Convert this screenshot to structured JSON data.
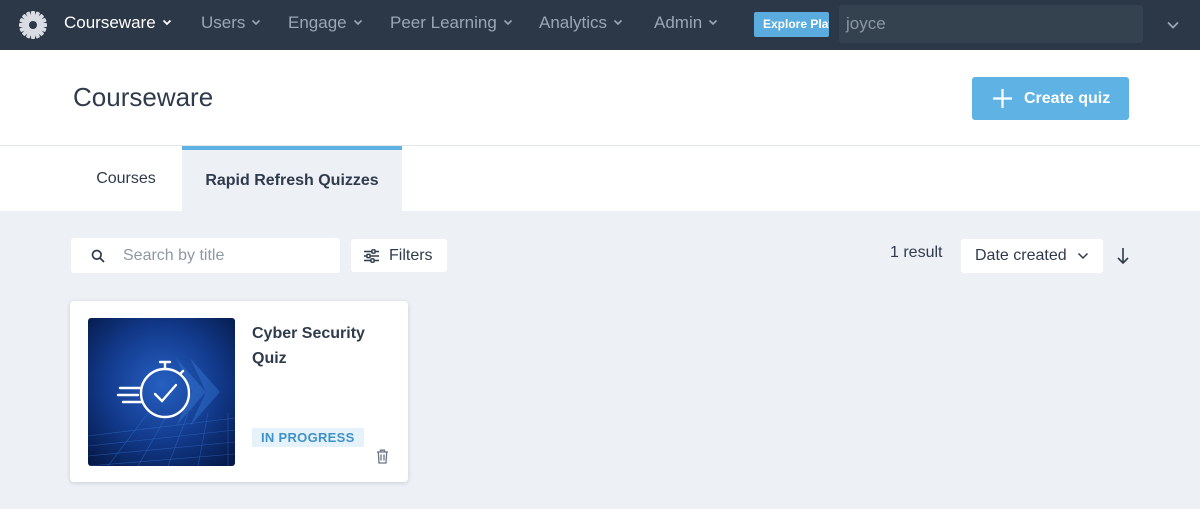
{
  "nav": {
    "items": [
      {
        "label": "Courseware",
        "active": true
      },
      {
        "label": "Users"
      },
      {
        "label": "Engage"
      },
      {
        "label": "Peer Learning"
      },
      {
        "label": "Analytics"
      },
      {
        "label": "Admin"
      }
    ],
    "explore_label": "Explore Plat",
    "search_value": "joyce"
  },
  "header": {
    "title": "Courseware",
    "create_button": "Create quiz"
  },
  "tabs": [
    {
      "label": "Courses"
    },
    {
      "label": "Rapid Refresh Quizzes",
      "selected": true
    }
  ],
  "toolbar": {
    "search_placeholder": "Search by title",
    "filters_label": "Filters",
    "result_count": "1 result",
    "sort_label": "Date created"
  },
  "cards": [
    {
      "title": "Cyber Security Quiz",
      "status": "IN PROGRESS"
    }
  ],
  "colors": {
    "nav_bg": "#2c3848",
    "accent": "#5eb3e4",
    "page_bg": "#edf0f5",
    "badge_text": "#3f92c8"
  }
}
